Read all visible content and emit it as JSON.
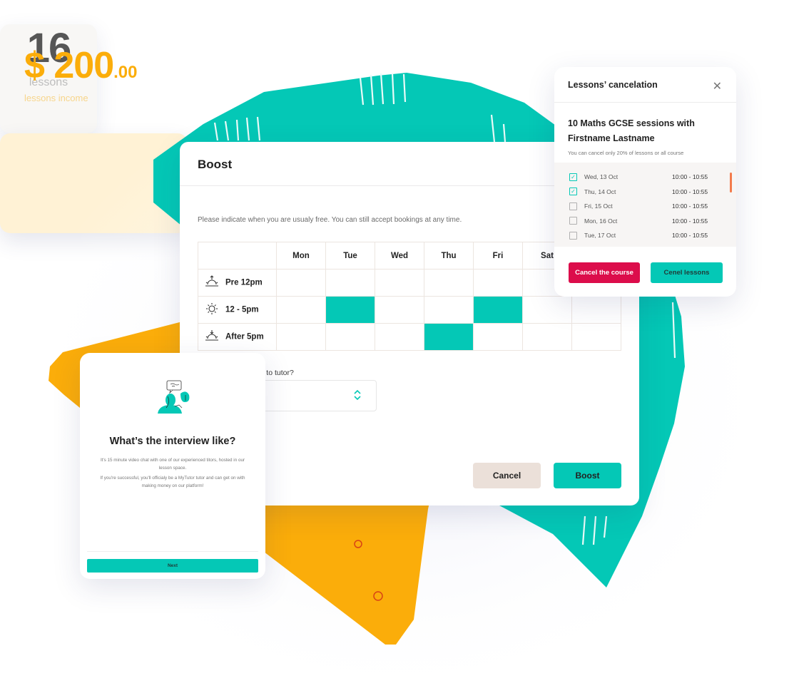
{
  "colors": {
    "teal": "#04c8b6",
    "orange": "#fbad0a",
    "red": "#dc0d4b",
    "beige": "#ebe0d9",
    "cream": "#fff2d5"
  },
  "stats_card": {
    "value": "16",
    "label": "lessons"
  },
  "boost_modal": {
    "title": "Boost",
    "description": "Please indicate when you are usualy free. You can still accept bookings at any time.",
    "days": [
      "Mon",
      "Tue",
      "Wed",
      "Thu",
      "Fri",
      "Sat",
      ""
    ],
    "slots": [
      {
        "label": "Pre 12pm",
        "icon": "sunrise-icon",
        "selected": [
          false,
          false,
          false,
          false,
          false,
          false,
          false
        ]
      },
      {
        "label": "12 - 5pm",
        "icon": "sun-icon",
        "selected": [
          false,
          true,
          false,
          false,
          true,
          false,
          false
        ]
      },
      {
        "label": "After 5pm",
        "icon": "sunset-icon",
        "selected": [
          false,
          false,
          false,
          true,
          false,
          false,
          false
        ]
      }
    ],
    "question": "week would you like to tutor?",
    "select_value": "",
    "cancel_label": "Cancel",
    "boost_label": "Boost"
  },
  "cancelation_popup": {
    "title": "Lessons’ cancelation",
    "course_title": "10 Maths GCSE sessions with Firstname Lastname",
    "subtitle": "You can cancel only 20% of lessons or all course",
    "lessons": [
      {
        "date": "Wed, 13 Oct",
        "time": "10:00 - 10:55",
        "checked": true
      },
      {
        "date": "Thu, 14 Oct",
        "time": "10:00 - 10:55",
        "checked": true
      },
      {
        "date": "Fri, 15 Oct",
        "time": "10:00 - 10:55",
        "checked": false
      },
      {
        "date": "Mon, 16 Oct",
        "time": "10:00 - 10:55",
        "checked": false
      },
      {
        "date": "Tue, 17 Oct",
        "time": "10:00 - 10:55",
        "checked": false
      }
    ],
    "cancel_course_label": "Cancel the course",
    "cancel_lessons_label": "Cenel lessons"
  },
  "interview_card": {
    "title": "What’s the interview like?",
    "paragraph1": "It's 15 minute video chat with one of our experienced titors, hosted in our lesson space.",
    "paragraph2": "If you're successful, you'll officialy be a MyTutor tutor and can get on with making money on our platform!",
    "next_label": "Next"
  },
  "income_card": {
    "amount": "$ 200",
    "cents": ".00",
    "label": "lessons income"
  }
}
